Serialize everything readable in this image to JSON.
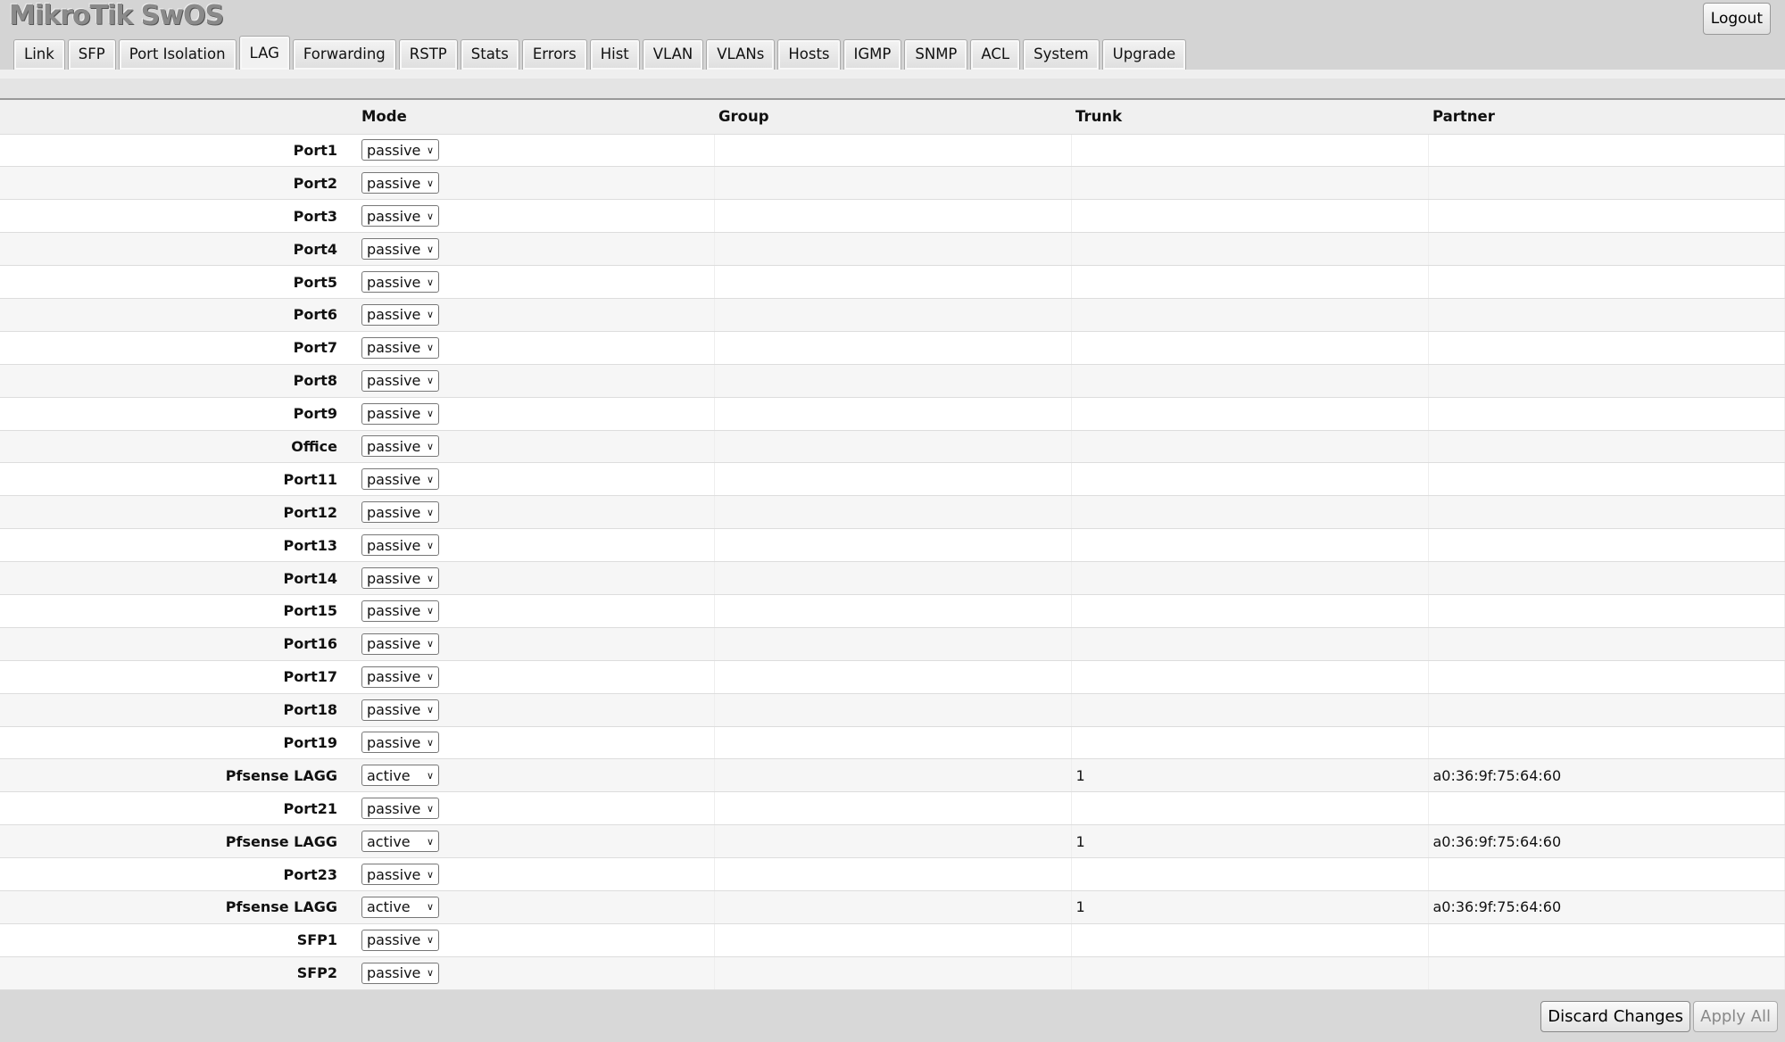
{
  "app": {
    "title": "MikroTik SwOS",
    "logout_label": "Logout"
  },
  "tabs": [
    "Link",
    "SFP",
    "Port Isolation",
    "LAG",
    "Forwarding",
    "RSTP",
    "Stats",
    "Errors",
    "Hist",
    "VLAN",
    "VLANs",
    "Hosts",
    "IGMP",
    "SNMP",
    "ACL",
    "System",
    "Upgrade"
  ],
  "active_tab": "LAG",
  "table": {
    "headers": [
      "",
      "Mode",
      "Group",
      "Trunk",
      "Partner"
    ],
    "rows": [
      {
        "port": "Port1",
        "mode": "passive",
        "group": "",
        "trunk": "",
        "partner": ""
      },
      {
        "port": "Port2",
        "mode": "passive",
        "group": "",
        "trunk": "",
        "partner": ""
      },
      {
        "port": "Port3",
        "mode": "passive",
        "group": "",
        "trunk": "",
        "partner": ""
      },
      {
        "port": "Port4",
        "mode": "passive",
        "group": "",
        "trunk": "",
        "partner": ""
      },
      {
        "port": "Port5",
        "mode": "passive",
        "group": "",
        "trunk": "",
        "partner": ""
      },
      {
        "port": "Port6",
        "mode": "passive",
        "group": "",
        "trunk": "",
        "partner": ""
      },
      {
        "port": "Port7",
        "mode": "passive",
        "group": "",
        "trunk": "",
        "partner": ""
      },
      {
        "port": "Port8",
        "mode": "passive",
        "group": "",
        "trunk": "",
        "partner": ""
      },
      {
        "port": "Port9",
        "mode": "passive",
        "group": "",
        "trunk": "",
        "partner": ""
      },
      {
        "port": "Office",
        "mode": "passive",
        "group": "",
        "trunk": "",
        "partner": ""
      },
      {
        "port": "Port11",
        "mode": "passive",
        "group": "",
        "trunk": "",
        "partner": ""
      },
      {
        "port": "Port12",
        "mode": "passive",
        "group": "",
        "trunk": "",
        "partner": ""
      },
      {
        "port": "Port13",
        "mode": "passive",
        "group": "",
        "trunk": "",
        "partner": ""
      },
      {
        "port": "Port14",
        "mode": "passive",
        "group": "",
        "trunk": "",
        "partner": ""
      },
      {
        "port": "Port15",
        "mode": "passive",
        "group": "",
        "trunk": "",
        "partner": ""
      },
      {
        "port": "Port16",
        "mode": "passive",
        "group": "",
        "trunk": "",
        "partner": ""
      },
      {
        "port": "Port17",
        "mode": "passive",
        "group": "",
        "trunk": "",
        "partner": ""
      },
      {
        "port": "Port18",
        "mode": "passive",
        "group": "",
        "trunk": "",
        "partner": ""
      },
      {
        "port": "Port19",
        "mode": "passive",
        "group": "",
        "trunk": "",
        "partner": ""
      },
      {
        "port": "Pfsense LAGG",
        "mode": "active",
        "group": "",
        "trunk": "1",
        "partner": "a0:36:9f:75:64:60"
      },
      {
        "port": "Port21",
        "mode": "passive",
        "group": "",
        "trunk": "",
        "partner": ""
      },
      {
        "port": "Pfsense LAGG",
        "mode": "active",
        "group": "",
        "trunk": "1",
        "partner": "a0:36:9f:75:64:60"
      },
      {
        "port": "Port23",
        "mode": "passive",
        "group": "",
        "trunk": "",
        "partner": ""
      },
      {
        "port": "Pfsense LAGG",
        "mode": "active",
        "group": "",
        "trunk": "1",
        "partner": "a0:36:9f:75:64:60"
      },
      {
        "port": "SFP1",
        "mode": "passive",
        "group": "",
        "trunk": "",
        "partner": ""
      },
      {
        "port": "SFP2",
        "mode": "passive",
        "group": "",
        "trunk": "",
        "partner": ""
      }
    ]
  },
  "footer": {
    "discard_label": "Discard Changes",
    "apply_label": "Apply All"
  }
}
